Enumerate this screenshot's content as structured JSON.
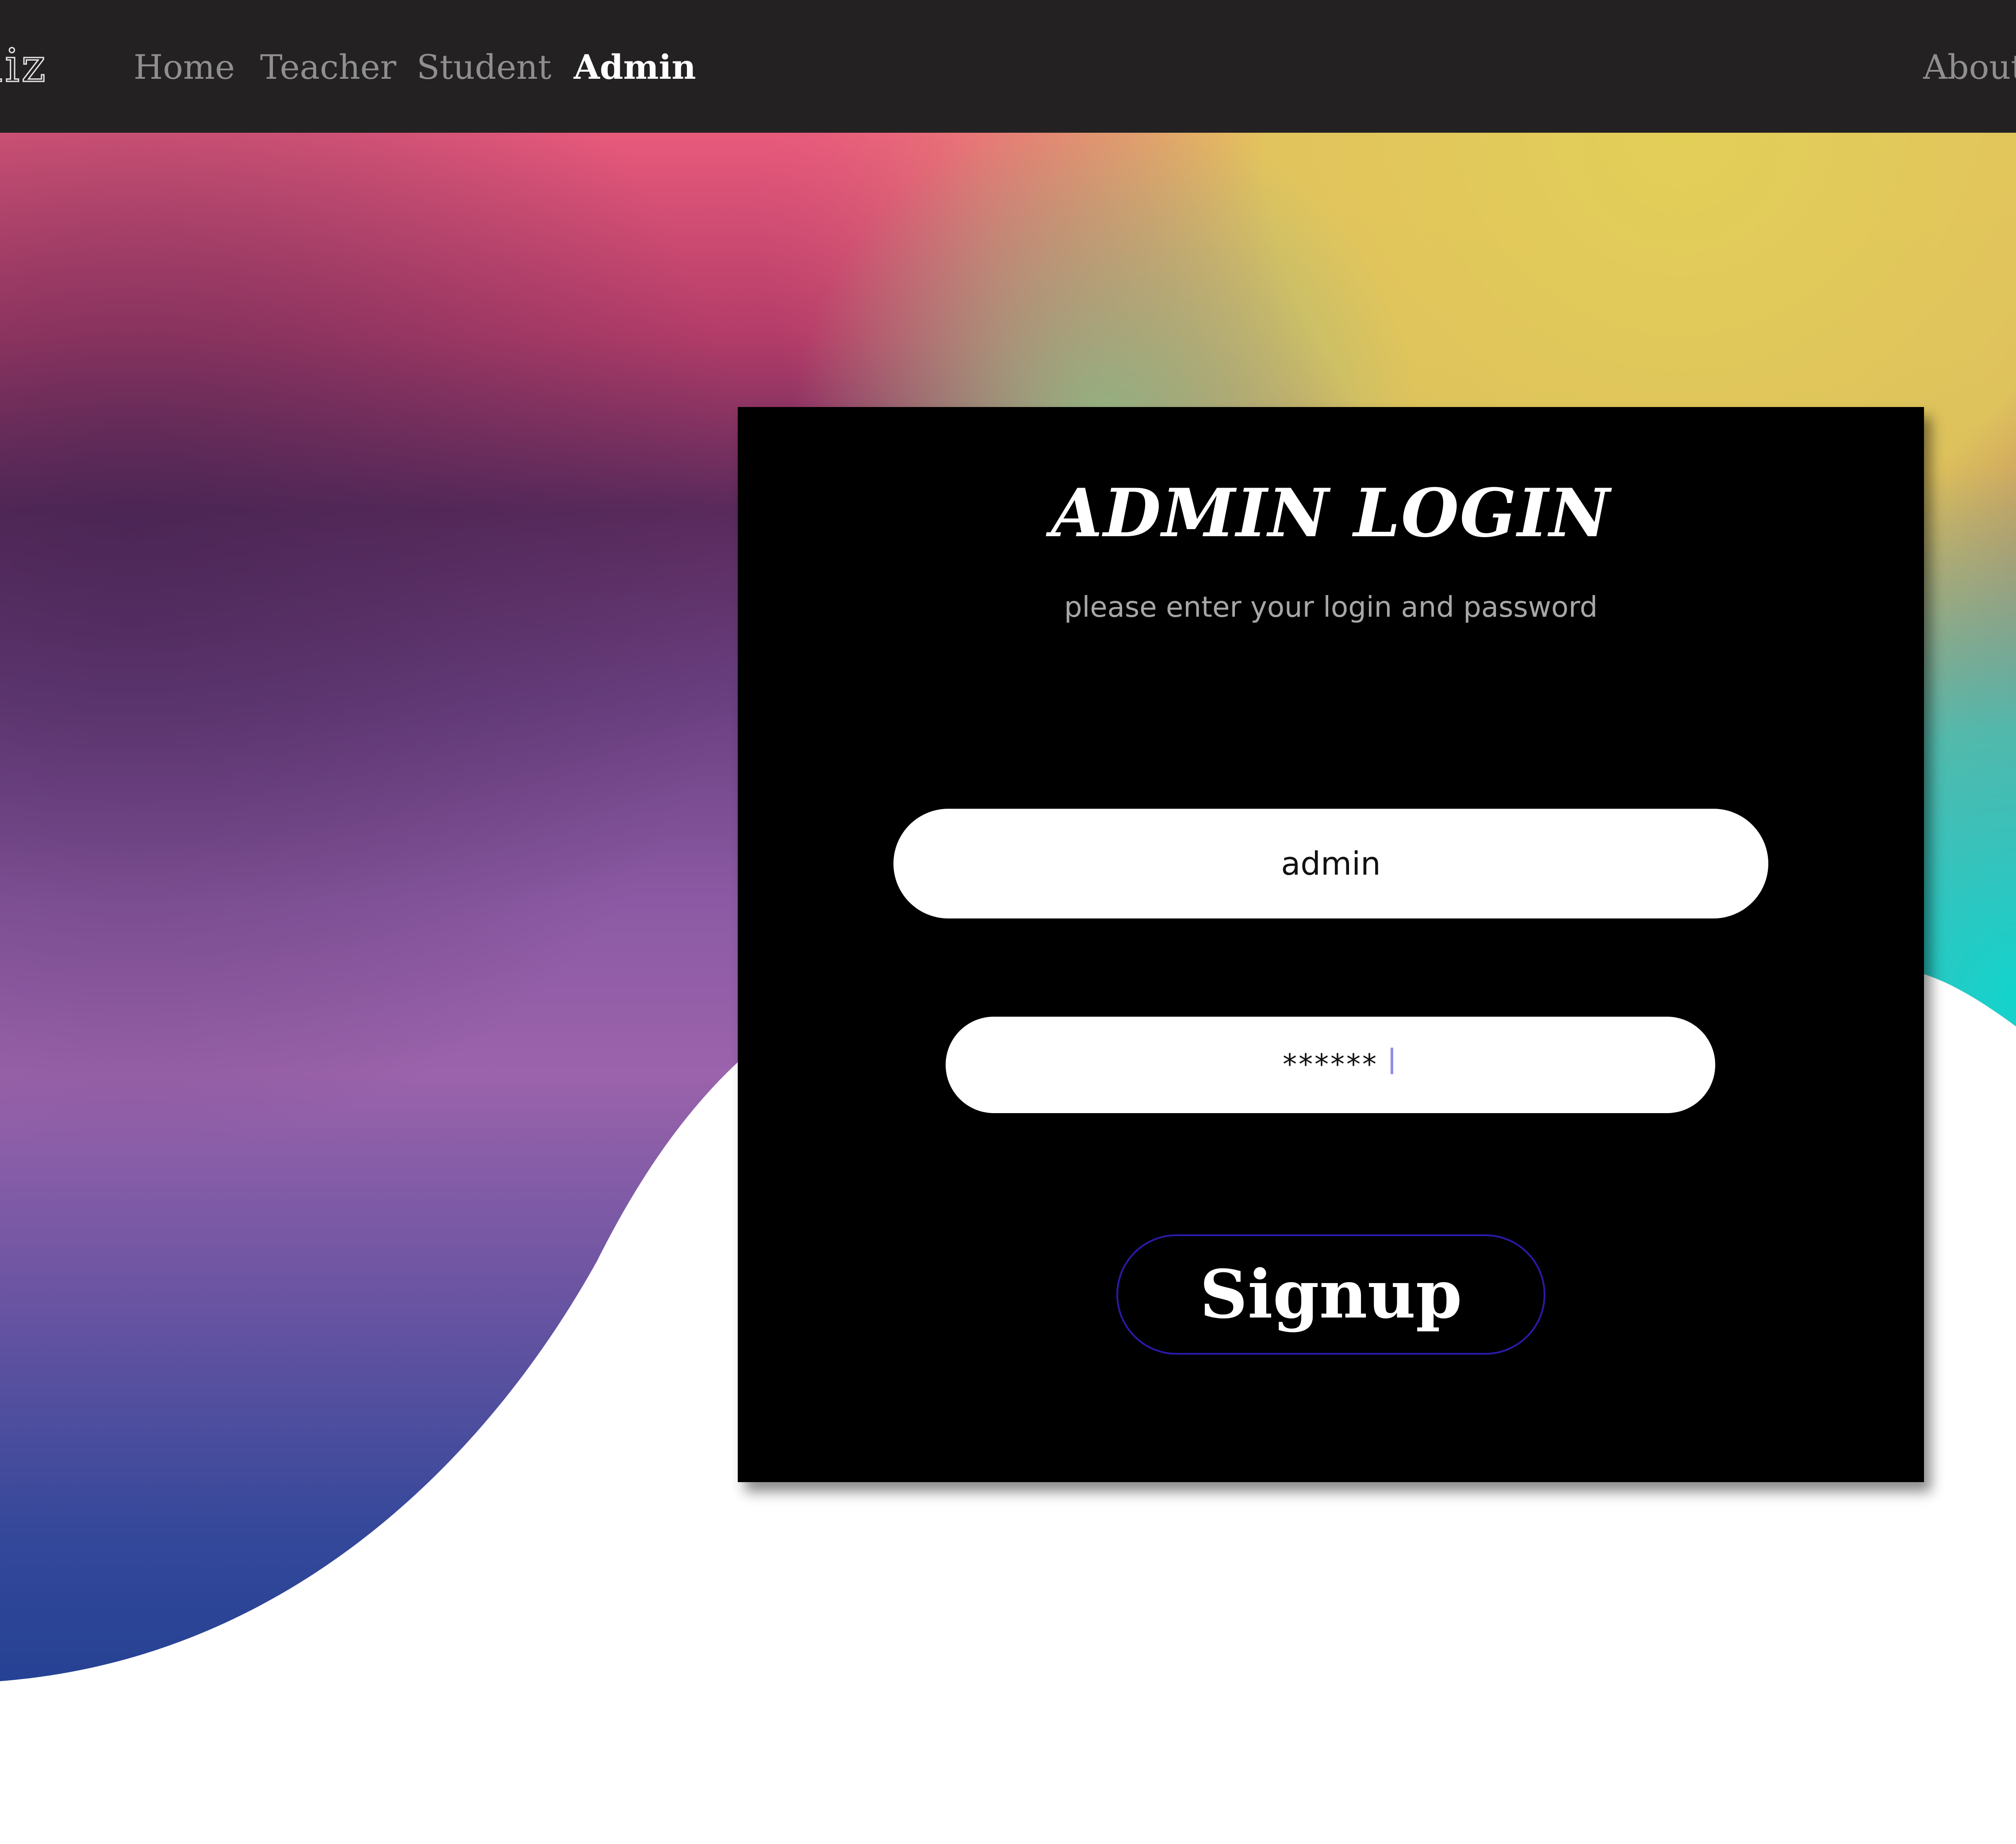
{
  "navbar": {
    "brand": "uiz",
    "links": [
      {
        "label": "Home"
      },
      {
        "label": "Teacher"
      },
      {
        "label": "Student"
      },
      {
        "label": "Admin",
        "active": true
      }
    ],
    "about": "About"
  },
  "login": {
    "title": "ADMIN LOGIN",
    "subtitle": "please enter your login and password",
    "username_value": "admin",
    "password_value": "******",
    "signup_label": "Signup"
  },
  "colors": {
    "navbar_bg": "#232122",
    "card_bg": "#000000",
    "button_border": "#2a1aa8",
    "gradient_pink": "#e85a7c",
    "gradient_yellow": "#e2cf58",
    "gradient_purple": "#9b63ab",
    "gradient_navy": "#163a8c",
    "gradient_teal": "#12d4cc"
  }
}
